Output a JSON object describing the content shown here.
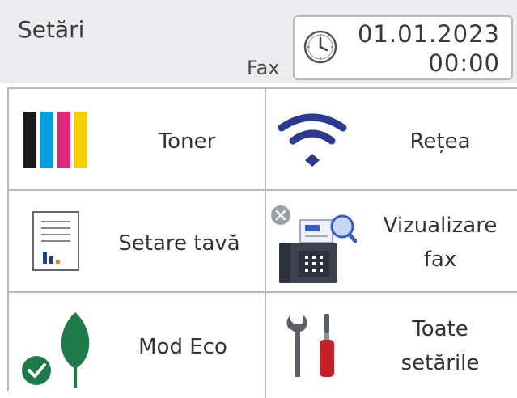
{
  "header": {
    "title": "Setări",
    "mode": "Fax",
    "date": "01.01.2023",
    "time": "00:00"
  },
  "menu": [
    {
      "label": "Toner",
      "icon": "toner-cartridges-icon"
    },
    {
      "label": "Rețea",
      "icon": "wifi-icon"
    },
    {
      "label": "Setare tavă",
      "icon": "paper-tray-icon"
    },
    {
      "label_line1": "Vizualizare",
      "label_line2": "fax",
      "icon": "fax-preview-icon"
    },
    {
      "label": "Mod Eco",
      "icon": "eco-leaf-icon"
    },
    {
      "label_line1": "Toate",
      "label_line2": "setările",
      "icon": "tools-icon"
    }
  ],
  "colors": {
    "header_bg": "#ececee",
    "divider": "#b9b9b9",
    "toner_black": "#1a1a1a",
    "toner_cyan": "#00a0e0",
    "toner_magenta": "#e0287a",
    "toner_yellow": "#f5d000",
    "wifi": "#2b3a8f",
    "eco_green": "#1f7a4a"
  }
}
